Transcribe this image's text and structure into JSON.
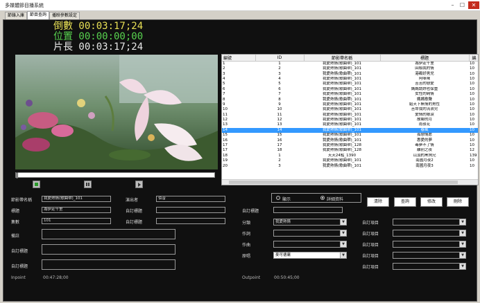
{
  "window": {
    "title": "多媒體節目播系統"
  },
  "window_buttons": {
    "minimize": "–",
    "maximize": "☐",
    "close": "✕"
  },
  "tabs": [
    {
      "label": "節錄入庫"
    },
    {
      "label": "節目查詢"
    },
    {
      "label": "播映參數設定"
    }
  ],
  "timers": {
    "countdown": "倒數 00:03:17;24",
    "position": "位置 00:00:00;00",
    "length": "片長 00:03:17;24"
  },
  "player": {
    "progress": 0
  },
  "grid": {
    "headers": [
      "編號",
      "ID",
      "節影帶名稱",
      "標題",
      "編"
    ],
    "rows": [
      [
        "1",
        "1",
        "我愛熱情(歌曲帶)_101",
        "為伊走千里",
        "10"
      ],
      [
        "2",
        "2",
        "我愛熱情(歌曲帶)_101",
        "回頭我的情",
        "10"
      ],
      [
        "3",
        "3",
        "我愛熱情(歌曲帶)_101",
        "港都好男兒",
        "10"
      ],
      [
        "4",
        "4",
        "我愛熱情(歌曲帶)_101",
        "阿咪咪",
        "10"
      ],
      [
        "5",
        "5",
        "我愛熱情(歌曲帶)_101",
        "苦苦的戀愛",
        "10"
      ],
      [
        "6",
        "6",
        "我愛熱情(歌曲帶)_101",
        "媽媽請妳也保重",
        "10"
      ],
      [
        "7",
        "7",
        "我愛熱情(歌曲帶)_101",
        "女性的純情",
        "10"
      ],
      [
        "8",
        "8",
        "我愛熱情(歌曲帶)_101",
        "媽媽歌聲",
        "10"
      ],
      [
        "9",
        "9",
        "我愛熱情(歌曲帶)_101",
        "給天下無情的男性",
        "10"
      ],
      [
        "10",
        "10",
        "我愛熱情(歌曲帶)_101",
        "苦命我的流浪兒",
        "10"
      ],
      [
        "11",
        "11",
        "我愛熱情(歌曲帶)_101",
        "愛情的眼淚",
        "10"
      ],
      [
        "12",
        "12",
        "我愛熱情(歌曲帶)_101",
        "故鄉的月",
        "10"
      ],
      [
        "13",
        "13",
        "我愛熱情(歌曲帶)_101",
        "雨夜花",
        "10"
      ],
      [
        "14",
        "14",
        "我愛熱情(歌曲帶)_101",
        "春風",
        "10"
      ],
      [
        "15",
        "15",
        "我愛熱情(歌曲帶)_101",
        "孤戀情愿",
        "10"
      ],
      [
        "16",
        "16",
        "我愛熱情(歌曲帶)_101",
        "惠愛的夢",
        "10"
      ],
      [
        "17",
        "17",
        "我愛熱情(歌曲帶)_128",
        "毒夢不了情",
        "10"
      ],
      [
        "17",
        "18",
        "我愛熱情(歌曲帶)_128",
        "離別之夜",
        "12"
      ],
      [
        "18",
        "1",
        "天天24點_1390",
        "山頂的黑狗兄",
        "139"
      ],
      [
        "19",
        "2",
        "我愛熱情(歌曲帶)_101",
        "南國月夜2",
        "10"
      ],
      [
        "20",
        "3",
        "我愛熱情(歌曲帶)_101",
        "南國月夜3",
        "10"
      ]
    ],
    "selected_index": 13
  },
  "form": {
    "tape_name": {
      "label": "節影帶名稱",
      "value": "我愛熱情(歌曲帶)_101"
    },
    "performer": {
      "label": "演出者",
      "value": "佰音"
    },
    "title": {
      "label": "標題",
      "value": "為伊走千里"
    },
    "custom_title_1": {
      "label": "自訂標題",
      "value": ""
    },
    "episode": {
      "label": "集數",
      "value": "101"
    },
    "custom_title_2": {
      "label": "自訂標題",
      "value": ""
    },
    "notes": {
      "label": "備註",
      "value": ""
    },
    "custom_title_3": {
      "label": "自訂標題",
      "value": ""
    },
    "custom_title_4": {
      "label": "自訂標題",
      "value": ""
    },
    "inpoint": {
      "label": "Inpoint",
      "value": "00:47:28;00"
    },
    "outpoint": {
      "label": "Outpoint",
      "value": "00:50:45;00"
    },
    "custom_title_5": {
      "label": "自訂標題",
      "value": ""
    },
    "category": {
      "label": "分類",
      "value": "我愛熱情"
    },
    "lyricist": {
      "label": "作詞",
      "value": ""
    },
    "composer": {
      "label": "作曲",
      "value": ""
    },
    "original_singer": {
      "label": "原唱",
      "value": "麥可德庸"
    },
    "custom_items": [
      "自訂項目",
      "自訂項目",
      "自訂項目",
      "自訂項目",
      "自訂項目"
    ]
  },
  "display_mode": {
    "show": "顯示",
    "detail": "詳細資料"
  },
  "buttons": {
    "clear": "清除",
    "query": "查詢",
    "edit": "修改",
    "delete": "刪除"
  }
}
